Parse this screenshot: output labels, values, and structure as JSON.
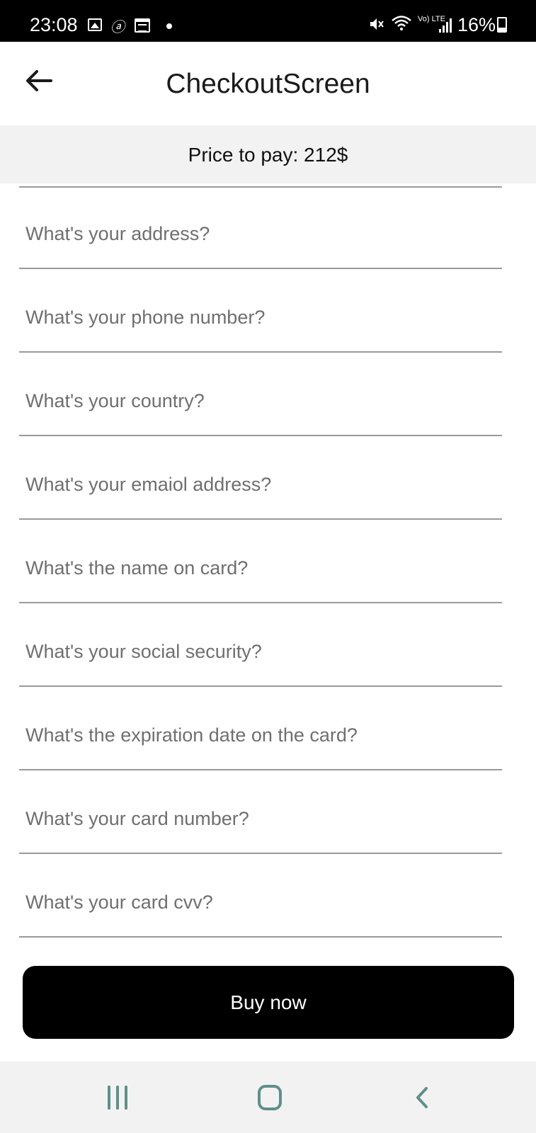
{
  "status_bar": {
    "time": "23:08",
    "battery": "16%",
    "icons": [
      "gallery-icon",
      "signature-icon",
      "calendar-icon",
      "dot-icon",
      "mute-icon",
      "wifi-icon",
      "volte-icon",
      "signal-icon",
      "battery-icon"
    ],
    "volte_label": "Vo) LTE"
  },
  "app_bar": {
    "title": "CheckoutScreen",
    "back_icon": "arrow-left-icon"
  },
  "price_banner": {
    "text": "Price to pay: 212$"
  },
  "form": {
    "fields": [
      {
        "placeholder": "What's your address?"
      },
      {
        "placeholder": "What's your phone number?"
      },
      {
        "placeholder": "What's your country?"
      },
      {
        "placeholder": "What's your emaiol address?"
      },
      {
        "placeholder": "What's the name on card?"
      },
      {
        "placeholder": "What's your social security?"
      },
      {
        "placeholder": "What's the expiration date on the card?"
      },
      {
        "placeholder": "What's your card number?"
      },
      {
        "placeholder": "What's your card cvv?"
      }
    ]
  },
  "buy_button": {
    "label": "Buy now"
  },
  "nav_bar": {
    "icons": [
      "recents-icon",
      "home-icon",
      "back-icon"
    ],
    "color": "#5f8f8b"
  }
}
